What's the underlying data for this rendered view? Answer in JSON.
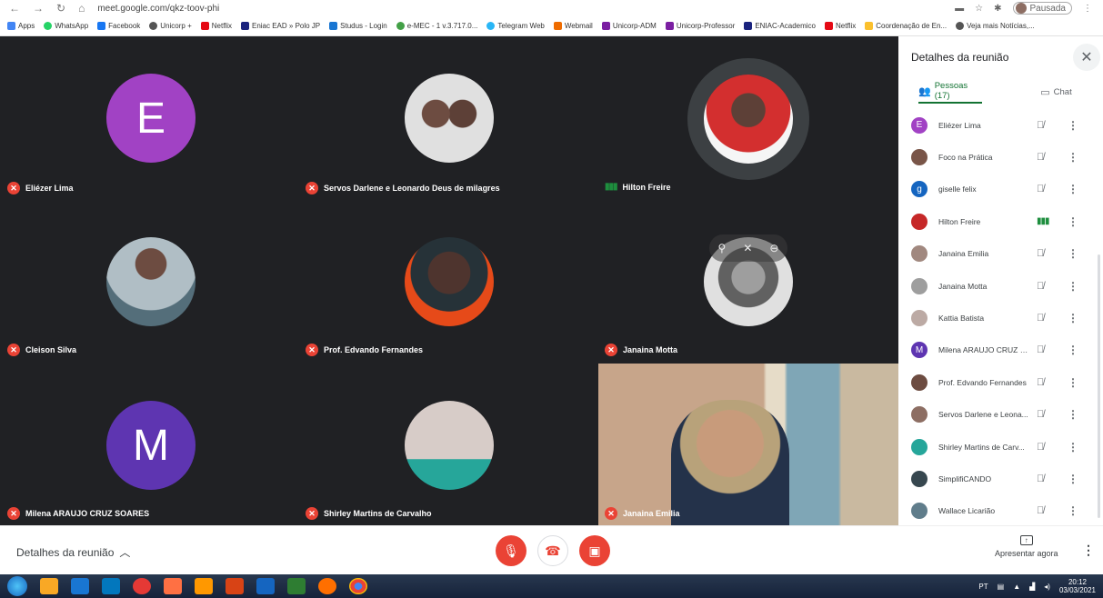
{
  "browser": {
    "url": "meet.google.com/qkz-toov-phi",
    "profile_label": "Pausada",
    "bookmarks": [
      "Apps",
      "WhatsApp",
      "Facebook",
      "Unicorp +",
      "Netflix",
      "Eniac EAD » Polo JP",
      "Studus - Login",
      "e-MEC - 1 v.3.717.0...",
      "Telegram Web",
      "Webmail",
      "Unicorp-ADM",
      "Unicorp-Professor",
      "ENIAC-Academico",
      "Netflix",
      "Coordenação de En...",
      "Veja mais Notícias,..."
    ]
  },
  "tiles": [
    {
      "name": "Eliézer Lima",
      "initial": "E",
      "color": "#a142c4"
    },
    {
      "name": "Servos Darlene e Leonardo Deus de milagres"
    },
    {
      "name": "Hilton Freire"
    },
    {
      "name": "Cleison Silva"
    },
    {
      "name": "Prof. Edvando Fernandes"
    },
    {
      "name": "Janaina Motta"
    },
    {
      "name": "Milena ARAUJO CRUZ SOARES",
      "initial": "M",
      "color": "#5e35b1"
    },
    {
      "name": "Shirley Martins de Carvalho"
    },
    {
      "name": "Janaina Emilia"
    }
  ],
  "panel": {
    "title": "Detalhes da reunião",
    "tab_people": "Pessoas (17)",
    "tab_chat": "Chat",
    "people": [
      {
        "name": "Eliézer Lima",
        "initial": "E",
        "color": "#a142c4",
        "mic": "off"
      },
      {
        "name": "Foco na Prática",
        "initial": "",
        "color": "#795548",
        "mic": "off"
      },
      {
        "name": "giselle felix",
        "initial": "g",
        "color": "#1565c0",
        "mic": "off"
      },
      {
        "name": "Hilton Freire",
        "initial": "",
        "color": "#c62828",
        "mic": "speaking"
      },
      {
        "name": "Janaina Emilia",
        "initial": "",
        "color": "#a1887f",
        "mic": "off"
      },
      {
        "name": "Janaina Motta",
        "initial": "",
        "color": "#9e9e9e",
        "mic": "off"
      },
      {
        "name": "Kattia Batista",
        "initial": "",
        "color": "#bcaaa4",
        "mic": "off"
      },
      {
        "name": "Milena ARAUJO CRUZ S...",
        "initial": "M",
        "color": "#5e35b1",
        "mic": "off"
      },
      {
        "name": "Prof. Edvando Fernandes",
        "initial": "",
        "color": "#6d4c41",
        "mic": "off"
      },
      {
        "name": "Servos Darlene e Leona...",
        "initial": "",
        "color": "#8d6e63",
        "mic": "off"
      },
      {
        "name": "Shirley Martins de Carv...",
        "initial": "",
        "color": "#26a69a",
        "mic": "off"
      },
      {
        "name": "SimplifiCANDO",
        "initial": "",
        "color": "#37474f",
        "mic": "off"
      },
      {
        "name": "Wallace Licarião",
        "initial": "",
        "color": "#607d8b",
        "mic": "off"
      }
    ]
  },
  "bottom": {
    "details_label": "Detalhes da reunião",
    "present_label": "Apresentar agora"
  },
  "taskbar": {
    "lang": "PT",
    "time": "20:12",
    "date": "03/03/2021"
  }
}
